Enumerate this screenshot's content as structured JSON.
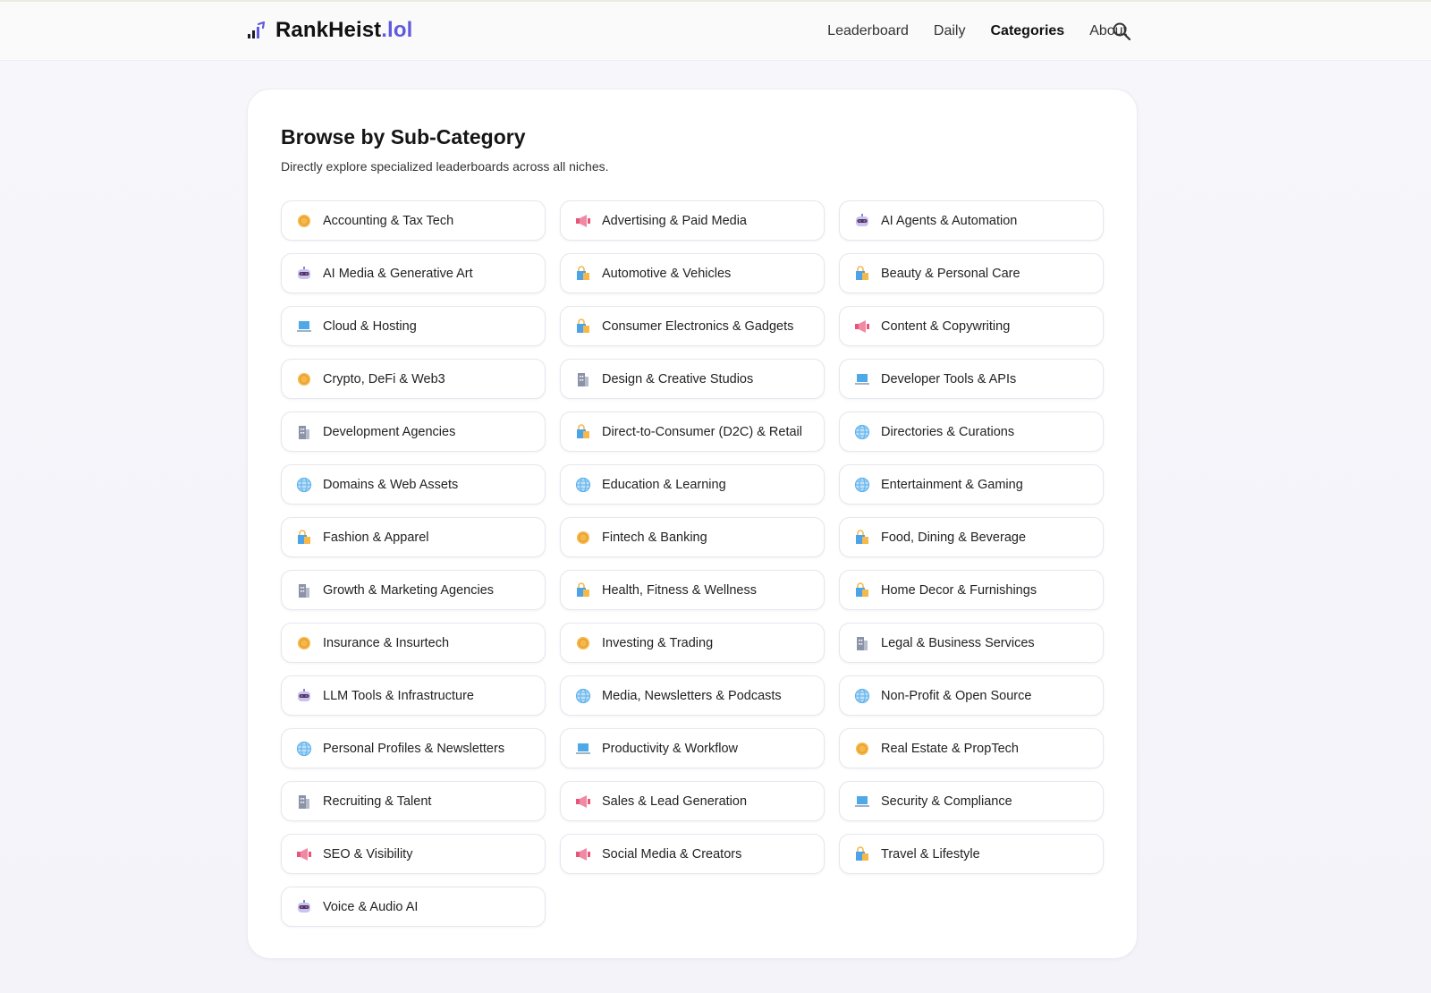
{
  "header": {
    "brand_name": "RankHeist",
    "brand_tld": ".lol",
    "nav": [
      {
        "label": "Leaderboard",
        "active": false
      },
      {
        "label": "Daily",
        "active": false
      },
      {
        "label": "Categories",
        "active": true
      },
      {
        "label": "About",
        "active": false
      }
    ]
  },
  "main": {
    "title": "Browse by Sub-Category",
    "subtitle": "Directly explore specialized leaderboards across all niches.",
    "categories": [
      {
        "label": "Accounting & Tax Tech",
        "icon": "coin-icon"
      },
      {
        "label": "Advertising & Paid Media",
        "icon": "megaphone-icon"
      },
      {
        "label": "AI Agents & Automation",
        "icon": "robot-icon"
      },
      {
        "label": "AI Media & Generative Art",
        "icon": "robot-icon"
      },
      {
        "label": "Automotive & Vehicles",
        "icon": "shopping-bag-icon"
      },
      {
        "label": "Beauty & Personal Care",
        "icon": "shopping-bag-icon"
      },
      {
        "label": "Cloud & Hosting",
        "icon": "laptop-icon"
      },
      {
        "label": "Consumer Electronics & Gadgets",
        "icon": "shopping-bag-icon"
      },
      {
        "label": "Content & Copywriting",
        "icon": "megaphone-icon"
      },
      {
        "label": "Crypto, DeFi & Web3",
        "icon": "coin-icon"
      },
      {
        "label": "Design & Creative Studios",
        "icon": "building-icon"
      },
      {
        "label": "Developer Tools & APIs",
        "icon": "laptop-icon"
      },
      {
        "label": "Development Agencies",
        "icon": "building-icon"
      },
      {
        "label": "Direct-to-Consumer (D2C) & Retail",
        "icon": "shopping-bag-icon"
      },
      {
        "label": "Directories & Curations",
        "icon": "globe-icon"
      },
      {
        "label": "Domains & Web Assets",
        "icon": "globe-icon"
      },
      {
        "label": "Education & Learning",
        "icon": "globe-icon"
      },
      {
        "label": "Entertainment & Gaming",
        "icon": "globe-icon"
      },
      {
        "label": "Fashion & Apparel",
        "icon": "shopping-bag-icon"
      },
      {
        "label": "Fintech & Banking",
        "icon": "coin-icon"
      },
      {
        "label": "Food, Dining & Beverage",
        "icon": "shopping-bag-icon"
      },
      {
        "label": "Growth & Marketing Agencies",
        "icon": "building-icon"
      },
      {
        "label": "Health, Fitness & Wellness",
        "icon": "shopping-bag-icon"
      },
      {
        "label": "Home Decor & Furnishings",
        "icon": "shopping-bag-icon"
      },
      {
        "label": "Insurance & Insurtech",
        "icon": "coin-icon"
      },
      {
        "label": "Investing & Trading",
        "icon": "coin-icon"
      },
      {
        "label": "Legal & Business Services",
        "icon": "building-icon"
      },
      {
        "label": "LLM Tools & Infrastructure",
        "icon": "robot-icon"
      },
      {
        "label": "Media, Newsletters & Podcasts",
        "icon": "globe-icon"
      },
      {
        "label": "Non-Profit & Open Source",
        "icon": "globe-icon"
      },
      {
        "label": "Personal Profiles & Newsletters",
        "icon": "globe-icon"
      },
      {
        "label": "Productivity & Workflow",
        "icon": "laptop-icon"
      },
      {
        "label": "Real Estate & PropTech",
        "icon": "coin-icon"
      },
      {
        "label": "Recruiting & Talent",
        "icon": "building-icon"
      },
      {
        "label": "Sales & Lead Generation",
        "icon": "megaphone-icon"
      },
      {
        "label": "Security & Compliance",
        "icon": "laptop-icon"
      },
      {
        "label": "SEO & Visibility",
        "icon": "megaphone-icon"
      },
      {
        "label": "Social Media & Creators",
        "icon": "megaphone-icon"
      },
      {
        "label": "Travel & Lifestyle",
        "icon": "shopping-bag-icon"
      },
      {
        "label": "Voice & Audio AI",
        "icon": "robot-icon"
      }
    ]
  },
  "colors": {
    "accent": "#5f5ae0",
    "coin": "#f5b84a",
    "megaphone": "#e9557a",
    "robot": "#8a84d6",
    "bag": "#4da3e8",
    "laptop": "#4fa9e6",
    "building": "#8b93a8",
    "globe": "#5fb2ec"
  }
}
